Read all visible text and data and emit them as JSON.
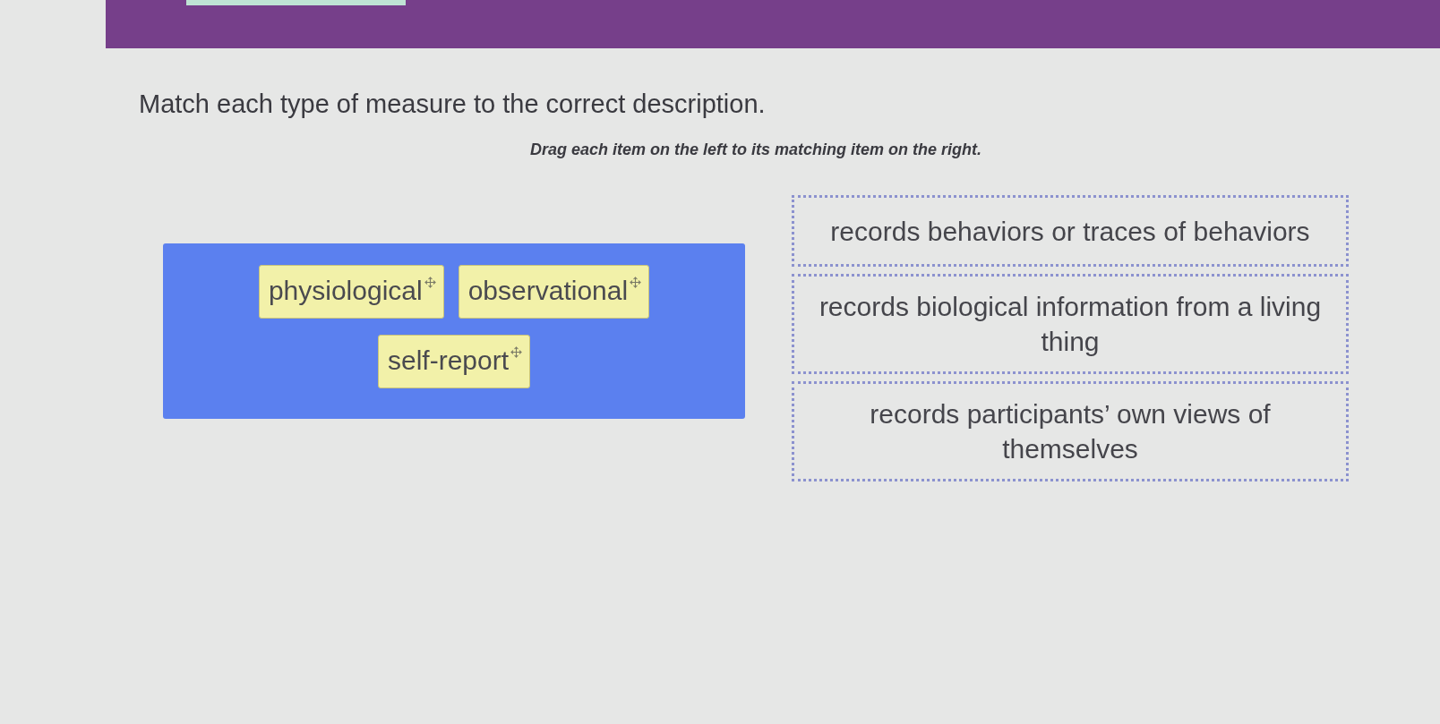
{
  "question": {
    "title": "Match each type of measure to the correct description.",
    "instruction": "Drag each item on the left to its matching item on the right."
  },
  "items": [
    {
      "label": "physiological"
    },
    {
      "label": "observational"
    },
    {
      "label": "self-report"
    }
  ],
  "targets": [
    {
      "text": "records behaviors or traces of behaviors"
    },
    {
      "text": "records biological information from a living thing"
    },
    {
      "text": "records participants’ own views of themselves"
    }
  ]
}
